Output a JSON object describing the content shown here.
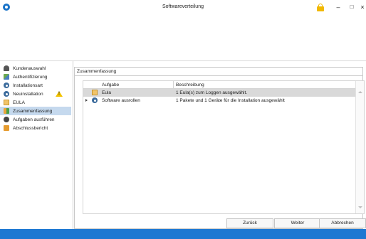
{
  "window": {
    "title": "Softwareverteilung",
    "controls": {
      "minimize": "–",
      "maximize": "□",
      "close": "×"
    }
  },
  "sidebar": {
    "items": [
      {
        "label": "Kundenauswahl",
        "icon": "user-icon"
      },
      {
        "label": "Authentifizierung",
        "icon": "auth-icon"
      },
      {
        "label": "Installationsart",
        "icon": "gear-icon"
      },
      {
        "label": "Neuinstallation",
        "icon": "gear-icon",
        "warning": true
      },
      {
        "label": "EULA",
        "icon": "document-icon"
      },
      {
        "label": "Zusammenfassung",
        "icon": "summary-icon",
        "active": true
      },
      {
        "label": "Aufgaben ausführen",
        "icon": "run-icon"
      },
      {
        "label": "Abschlussbericht",
        "icon": "report-icon"
      }
    ]
  },
  "group": {
    "title": "Zusammenfassung"
  },
  "table": {
    "columns": [
      "Aufgabe",
      "Beschreibung"
    ],
    "rows": [
      {
        "task": "Eula",
        "description": "1 Eula(s) zum Loggen ausgewählt.",
        "icon": "document-icon",
        "expandable": false,
        "selected": true
      },
      {
        "task": "Software ausrollen",
        "description": "1 Pakete und 1 Geräte für die Installation ausgewählt",
        "icon": "gear-icon",
        "expandable": true,
        "selected": false
      }
    ]
  },
  "footer": {
    "back_label": "Zurück",
    "next_label": "Weiter",
    "cancel_label": "Abbrechen"
  },
  "colors": {
    "accent": "#1e78d2",
    "active_nav": "#c5d9ee",
    "selected_row": "#d9d9d9",
    "lock": "#f1b800",
    "warning": "#f2c200"
  }
}
